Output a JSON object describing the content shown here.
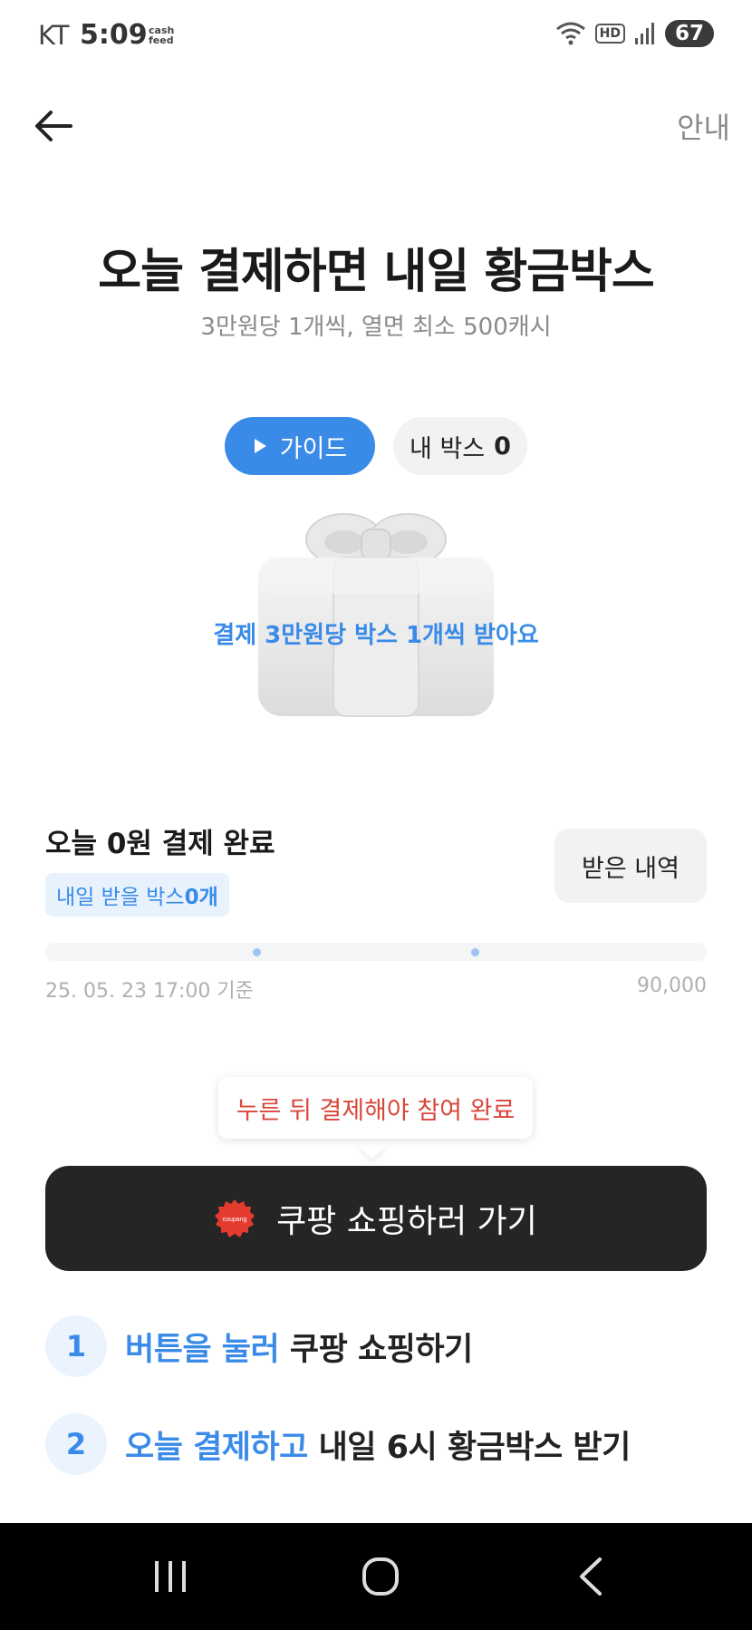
{
  "status_bar": {
    "carrier": "KT",
    "time": "5:09",
    "app_badge_line1": "cash",
    "app_badge_line2": "feed",
    "hd_label": "HD",
    "battery": "67"
  },
  "header": {
    "back_icon": "arrow-left-icon",
    "info_label": "안내"
  },
  "hero": {
    "title": "오늘 결제하면 내일 황금박스",
    "subtitle": "3만원당 1개씩, 열면 최소 500캐시"
  },
  "pills": {
    "guide_label": "가이드",
    "mybox_label": "내 박스",
    "mybox_count": "0"
  },
  "gift": {
    "icon": "gift-box-icon",
    "caption": "결제 3만원당 박스 1개씩 받아요"
  },
  "summary": {
    "paid_title": "오늘 0원 결제 완료",
    "box_tag_prefix": "내일 받을 박스 ",
    "box_tag_count": "0개",
    "history_label": "받은 내역",
    "progress_amount": 0,
    "progress_max": 90000,
    "progress_start_label": "25. 05. 23 17:00 기준",
    "progress_end_label": "90,000"
  },
  "cta": {
    "tooltip": "누른 뒤 결제해야 참여 완료",
    "badge_text": "coupang",
    "label": "쿠팡 쇼핑하러 가기"
  },
  "steps": [
    {
      "num": "1",
      "highlight": "버튼을 눌러",
      "rest": " 쿠팡 쇼핑하기"
    },
    {
      "num": "2",
      "highlight": "오늘 결제하고",
      "rest": " 내일 6시 황금박스 받기"
    }
  ],
  "colors": {
    "accent_blue": "#3a8ae8",
    "cta_dark": "#252525",
    "tooltip_red": "#d9473b",
    "coupang_red": "#e53b2f"
  },
  "nav": {
    "recent_icon": "recent-apps-icon",
    "home_icon": "home-icon",
    "back_icon": "back-chevron-icon"
  }
}
